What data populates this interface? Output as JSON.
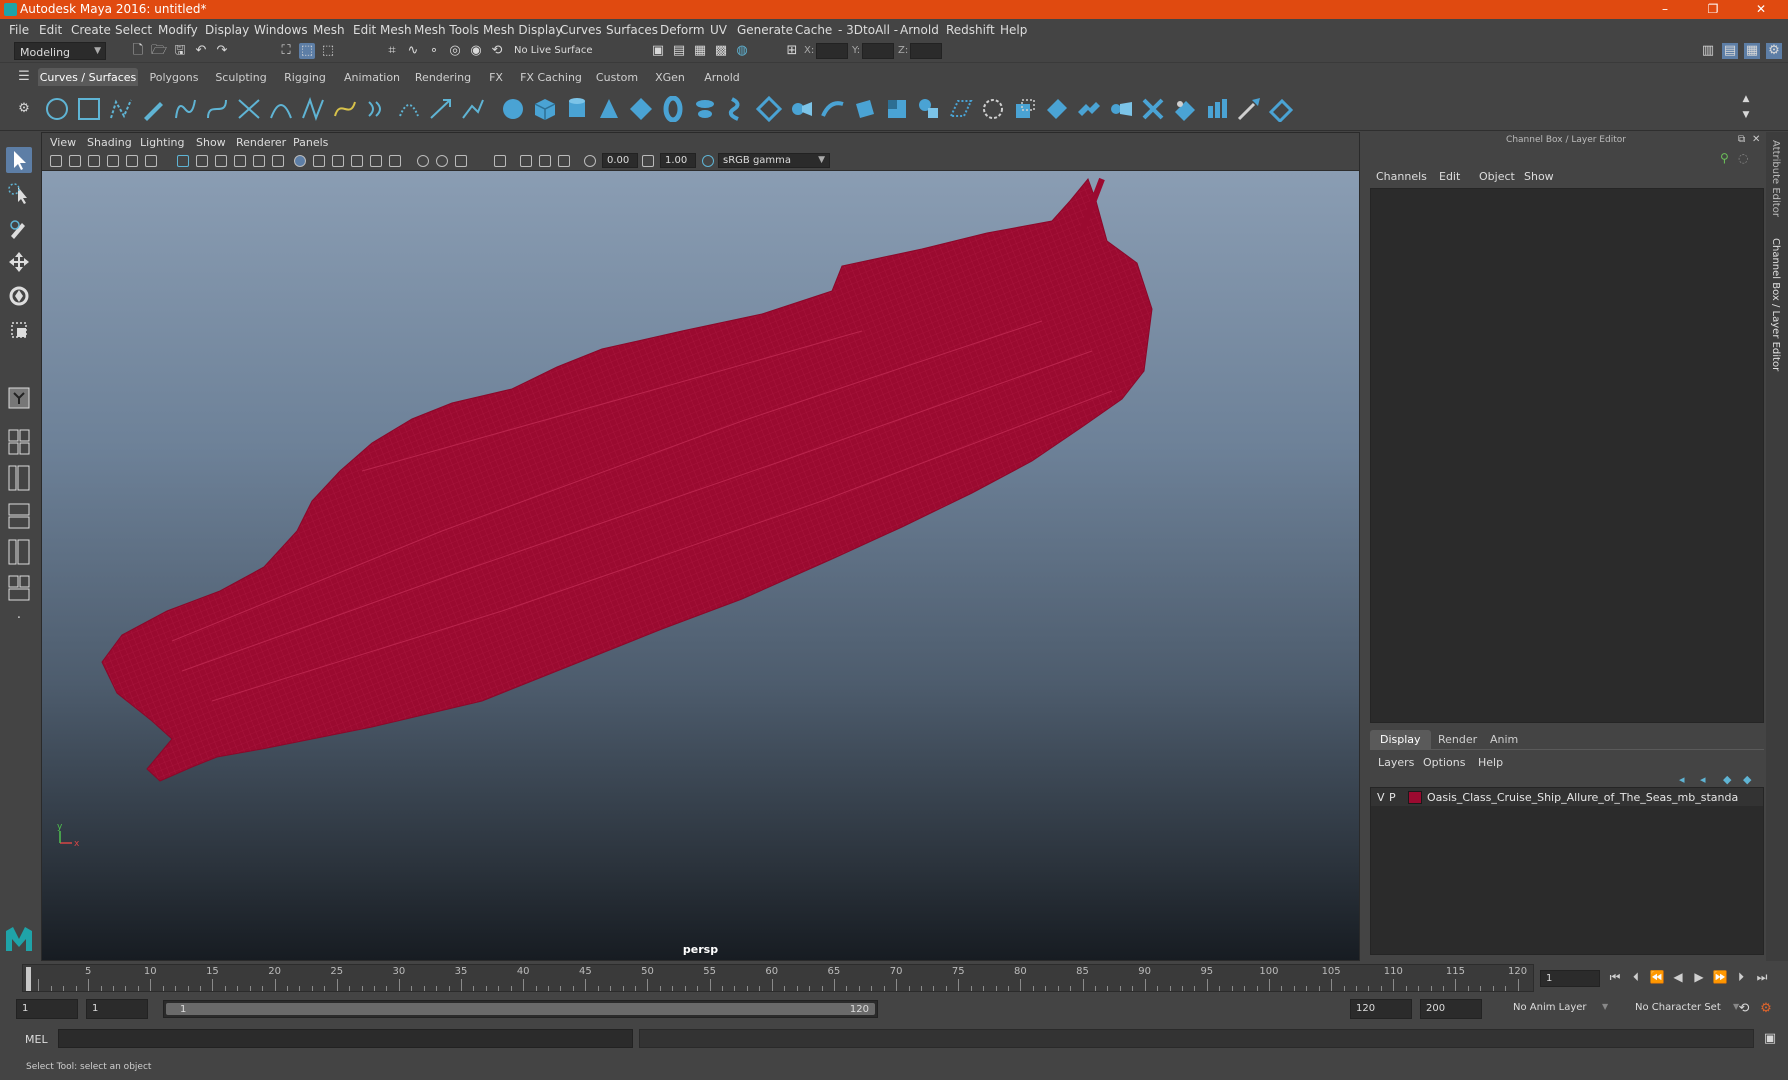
{
  "window": {
    "title": "Autodesk Maya 2016: untitled*",
    "minimize": "–",
    "maximize": "❐",
    "close": "✕"
  },
  "menubar": [
    "File",
    "Edit",
    "Create",
    "Select",
    "Modify",
    "Display",
    "Windows",
    "Mesh",
    "Edit Mesh",
    "Mesh Tools",
    "Mesh Display",
    "Curves",
    "Surfaces",
    "Deform",
    "UV",
    "Generate",
    "Cache",
    "- 3DtoAll -",
    "Arnold",
    "Redshift",
    "Help"
  ],
  "statusline": {
    "menuset": "Modeling",
    "live_surface": "No Live Surface",
    "x_label": "X:",
    "y_label": "Y:",
    "z_label": "Z:"
  },
  "shelf": {
    "tabs": [
      "Curves / Surfaces",
      "Polygons",
      "Sculpting",
      "Rigging",
      "Animation",
      "Rendering",
      "FX",
      "FX Caching",
      "Custom",
      "XGen",
      "Arnold"
    ],
    "active_tab": "Curves / Surfaces"
  },
  "viewport": {
    "menu": [
      "View",
      "Shading",
      "Lighting",
      "Show",
      "Renderer",
      "Panels"
    ],
    "exposure": "0.00",
    "gamma": "1.00",
    "color_space": "sRGB gamma",
    "camera_label": "persp",
    "axis_x": "x",
    "axis_y": "y",
    "mesh_color": "#9b0a30"
  },
  "channel_box": {
    "title": "Channel Box / Layer Editor",
    "menu": [
      "Channels",
      "Edit",
      "Object",
      "Show"
    ]
  },
  "layer_editor": {
    "tabs": [
      "Display",
      "Render",
      "Anim"
    ],
    "active_tab": "Display",
    "menu": [
      "Layers",
      "Options",
      "Help"
    ],
    "layers": [
      {
        "visible": "V",
        "playback": "P",
        "name": "Oasis_Class_Cruise_Ship_Allure_of_The_Seas_mb_standa",
        "color": "#9b0a30"
      }
    ]
  },
  "side_tabs": [
    "Attribute Editor",
    "Channel Box / Layer Editor"
  ],
  "timeline": {
    "ticks": [
      1,
      5,
      10,
      15,
      20,
      25,
      30,
      35,
      40,
      45,
      50,
      55,
      60,
      65,
      70,
      75,
      80,
      85,
      90,
      95,
      100,
      105,
      110,
      115,
      120
    ],
    "current_frame": "1"
  },
  "range": {
    "start": "1",
    "playback_start": "1",
    "slider_start": "1",
    "slider_end": "120",
    "playback_end": "120",
    "end": "200",
    "anim_layer": "No Anim Layer",
    "character_set": "No Character Set"
  },
  "command_line": {
    "label": "MEL"
  },
  "help_line": "Select Tool: select an object"
}
